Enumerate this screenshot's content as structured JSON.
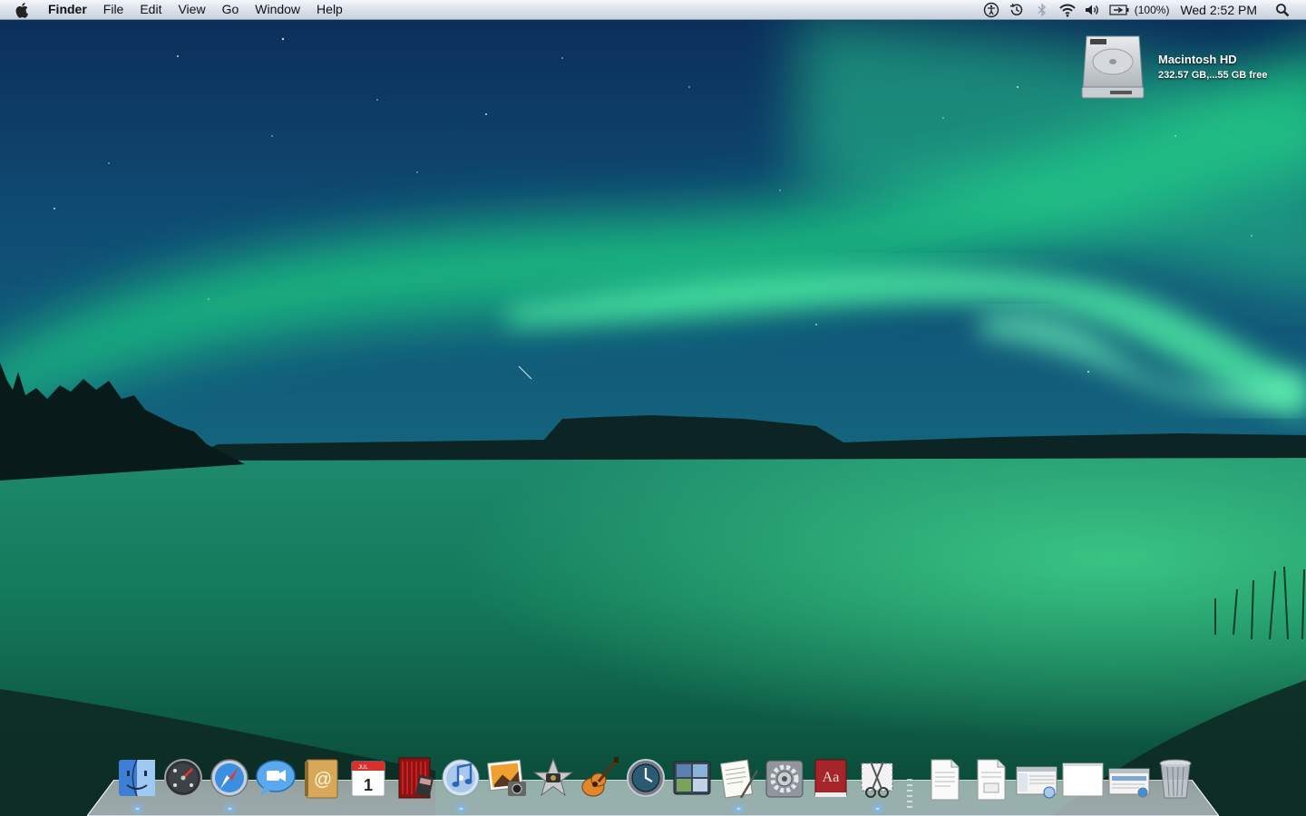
{
  "menubar": {
    "app_name": "Finder",
    "menus": [
      "File",
      "Edit",
      "View",
      "Go",
      "Window",
      "Help"
    ],
    "battery_percent": "(100%)",
    "clock": "Wed 2:52 PM"
  },
  "desktop": {
    "drive": {
      "name": "Macintosh HD",
      "info": "232.57 GB,...55 GB free"
    }
  },
  "dock": {
    "apps": [
      {
        "icon": "finder-icon",
        "running": true
      },
      {
        "icon": "dashboard-icon",
        "running": false
      },
      {
        "icon": "safari-icon",
        "running": true
      },
      {
        "icon": "ichat-icon",
        "running": false
      },
      {
        "icon": "address-book-icon",
        "running": false
      },
      {
        "icon": "ical-icon",
        "running": false
      },
      {
        "icon": "photo-booth-icon",
        "running": false
      },
      {
        "icon": "itunes-icon",
        "running": true
      },
      {
        "icon": "iphoto-icon",
        "running": false
      },
      {
        "icon": "imovie-icon",
        "running": false
      },
      {
        "icon": "garageband-icon",
        "running": false
      },
      {
        "icon": "time-machine-icon",
        "running": false
      },
      {
        "icon": "spaces-icon",
        "running": false
      },
      {
        "icon": "textedit-icon",
        "running": true
      },
      {
        "icon": "system-preferences-icon",
        "running": false
      },
      {
        "icon": "dictionary-icon",
        "running": false
      },
      {
        "icon": "grab-icon",
        "running": true
      }
    ],
    "calendar": {
      "month": "JUL",
      "day": "1"
    },
    "dictionary_label": "Aa",
    "documents": [
      {
        "icon": "document-icon"
      },
      {
        "icon": "pdf-document-icon"
      },
      {
        "icon": "itunes-window-thumbnail-icon"
      },
      {
        "icon": "blank-window-thumbnail-icon"
      },
      {
        "icon": "safari-window-thumbnail-icon"
      },
      {
        "icon": "trash-icon"
      }
    ]
  }
}
